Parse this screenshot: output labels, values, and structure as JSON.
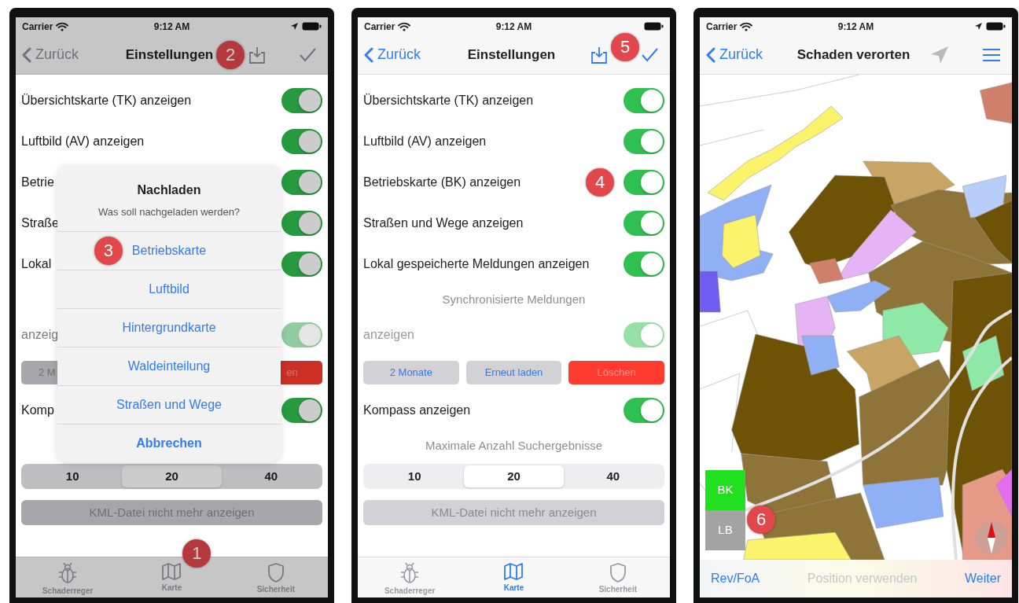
{
  "phones": [
    {
      "kind": "settings",
      "dimmed": true,
      "status": {
        "carrier": "Carrier",
        "time": "9:12 AM",
        "location": true
      },
      "nav": {
        "back": "Zurück",
        "title": "Einstellungen",
        "title_callout": "2",
        "actions": [
          {
            "kind": "download",
            "disabled": false
          },
          {
            "kind": "done",
            "disabled": false
          }
        ]
      },
      "rows": [
        {
          "kind": "toggle",
          "label": "Übersichtskarte (TK) anzeigen",
          "on": true,
          "disabled": false
        },
        {
          "kind": "toggle",
          "label": "Luftbild (AV) anzeigen",
          "on": true,
          "disabled": false
        },
        {
          "kind": "toggle",
          "label": "Betrie",
          "on": true,
          "disabled": false
        },
        {
          "kind": "toggle",
          "label": "Straße",
          "on": true,
          "disabled": false
        },
        {
          "kind": "toggle",
          "label": "Lokal",
          "on": true,
          "disabled": false
        },
        {
          "kind": "gap"
        },
        {
          "kind": "toggle",
          "label": "anzeig",
          "on": true,
          "disabled": true
        },
        {
          "kind": "buttons",
          "items": [
            {
              "label": "2 M",
              "kind": "plain"
            },
            {
              "label": "en",
              "kind": "destructive"
            }
          ]
        },
        {
          "kind": "toggle",
          "label": "Komp",
          "on": true,
          "disabled": false
        },
        {
          "kind": "gap"
        },
        {
          "kind": "segmented",
          "items": [
            {
              "label": "10",
              "selected": false
            },
            {
              "label": "20",
              "selected": true
            },
            {
              "label": "40",
              "selected": false
            }
          ]
        },
        {
          "kind": "wide-button",
          "label": "KML-Datei nicht mehr anzeigen",
          "disabled": true
        }
      ],
      "sheet": {
        "title": "Nachladen",
        "message": "Was soll nachgeladen werden?",
        "options": [
          {
            "label": "Betriebskarte",
            "kind": "default",
            "callout": "3"
          },
          {
            "label": "Luftbild",
            "kind": "default"
          },
          {
            "label": "Hintergrundkarte",
            "kind": "default"
          },
          {
            "label": "Waldeinteilung",
            "kind": "default"
          },
          {
            "label": "Straßen und Wege",
            "kind": "default"
          },
          {
            "label": "Abbrechen",
            "kind": "cancel"
          }
        ]
      },
      "tabs": [
        {
          "label": "Schaderreger",
          "kind": "bug",
          "selected": false
        },
        {
          "label": "Karte",
          "kind": "map",
          "selected": false,
          "callout": "1"
        },
        {
          "label": "Sicherheit",
          "kind": "shield",
          "selected": false
        }
      ]
    },
    {
      "kind": "settings",
      "dimmed": false,
      "status": {
        "carrier": "Carrier",
        "time": "9:12 AM",
        "location": false
      },
      "nav": {
        "back": "Zurück",
        "title": "Einstellungen",
        "actions": [
          {
            "kind": "download",
            "disabled": false
          },
          {
            "kind": "done",
            "disabled": false,
            "callout": "5"
          }
        ]
      },
      "rows": [
        {
          "kind": "toggle",
          "label": "Übersichtskarte (TK) anzeigen",
          "on": true,
          "disabled": false
        },
        {
          "kind": "toggle",
          "label": "Luftbild (AV) anzeigen",
          "on": true,
          "disabled": false
        },
        {
          "kind": "toggle",
          "label": "Betriebskarte (BK) anzeigen",
          "on": true,
          "disabled": false,
          "callout": "4"
        },
        {
          "kind": "toggle",
          "label": "Straßen und Wege anzeigen",
          "on": true,
          "disabled": false
        },
        {
          "kind": "toggle",
          "label": "Lokal gespeicherte Meldungen anzeigen",
          "on": true,
          "disabled": false
        },
        {
          "kind": "header",
          "label": "Synchronisierte Meldungen"
        },
        {
          "kind": "toggle",
          "label": "anzeigen",
          "on": true,
          "disabled": true
        },
        {
          "kind": "buttons",
          "items": [
            {
              "label": "2 Monate",
              "kind": "plain"
            },
            {
              "label": "Erneut laden",
              "kind": "plain"
            },
            {
              "label": "Löschen",
              "kind": "destructive"
            }
          ]
        },
        {
          "kind": "toggle",
          "label": "Kompass anzeigen",
          "on": true,
          "disabled": false
        },
        {
          "kind": "header",
          "label": "Maximale Anzahl Suchergebnisse"
        },
        {
          "kind": "segmented",
          "items": [
            {
              "label": "10",
              "selected": false
            },
            {
              "label": "20",
              "selected": true
            },
            {
              "label": "40",
              "selected": false
            }
          ]
        },
        {
          "kind": "wide-button",
          "label": "KML-Datei nicht mehr anzeigen",
          "disabled": true
        }
      ],
      "tabs": [
        {
          "label": "Schaderreger",
          "kind": "bug",
          "selected": false
        },
        {
          "label": "Karte",
          "kind": "map",
          "selected": true
        },
        {
          "label": "Sicherheit",
          "kind": "shield",
          "selected": false
        }
      ]
    },
    {
      "kind": "map",
      "dimmed": false,
      "status": {
        "carrier": "Carrier",
        "time": "9:12 AM",
        "location": true
      },
      "nav": {
        "back": "Zurück",
        "title": "Schaden verorten",
        "actions": [
          {
            "kind": "locate",
            "disabled": true
          },
          {
            "kind": "menu",
            "disabled": false
          }
        ]
      },
      "layers": {
        "callout": "6",
        "items": [
          {
            "label": "BK",
            "selected": true
          },
          {
            "label": "LB",
            "selected": false
          }
        ]
      },
      "toolbar": [
        {
          "label": "Rev/FoA",
          "disabled": false
        },
        {
          "label": "Position verwenden",
          "disabled": true
        },
        {
          "label": "Weiter",
          "disabled": false
        }
      ]
    }
  ]
}
